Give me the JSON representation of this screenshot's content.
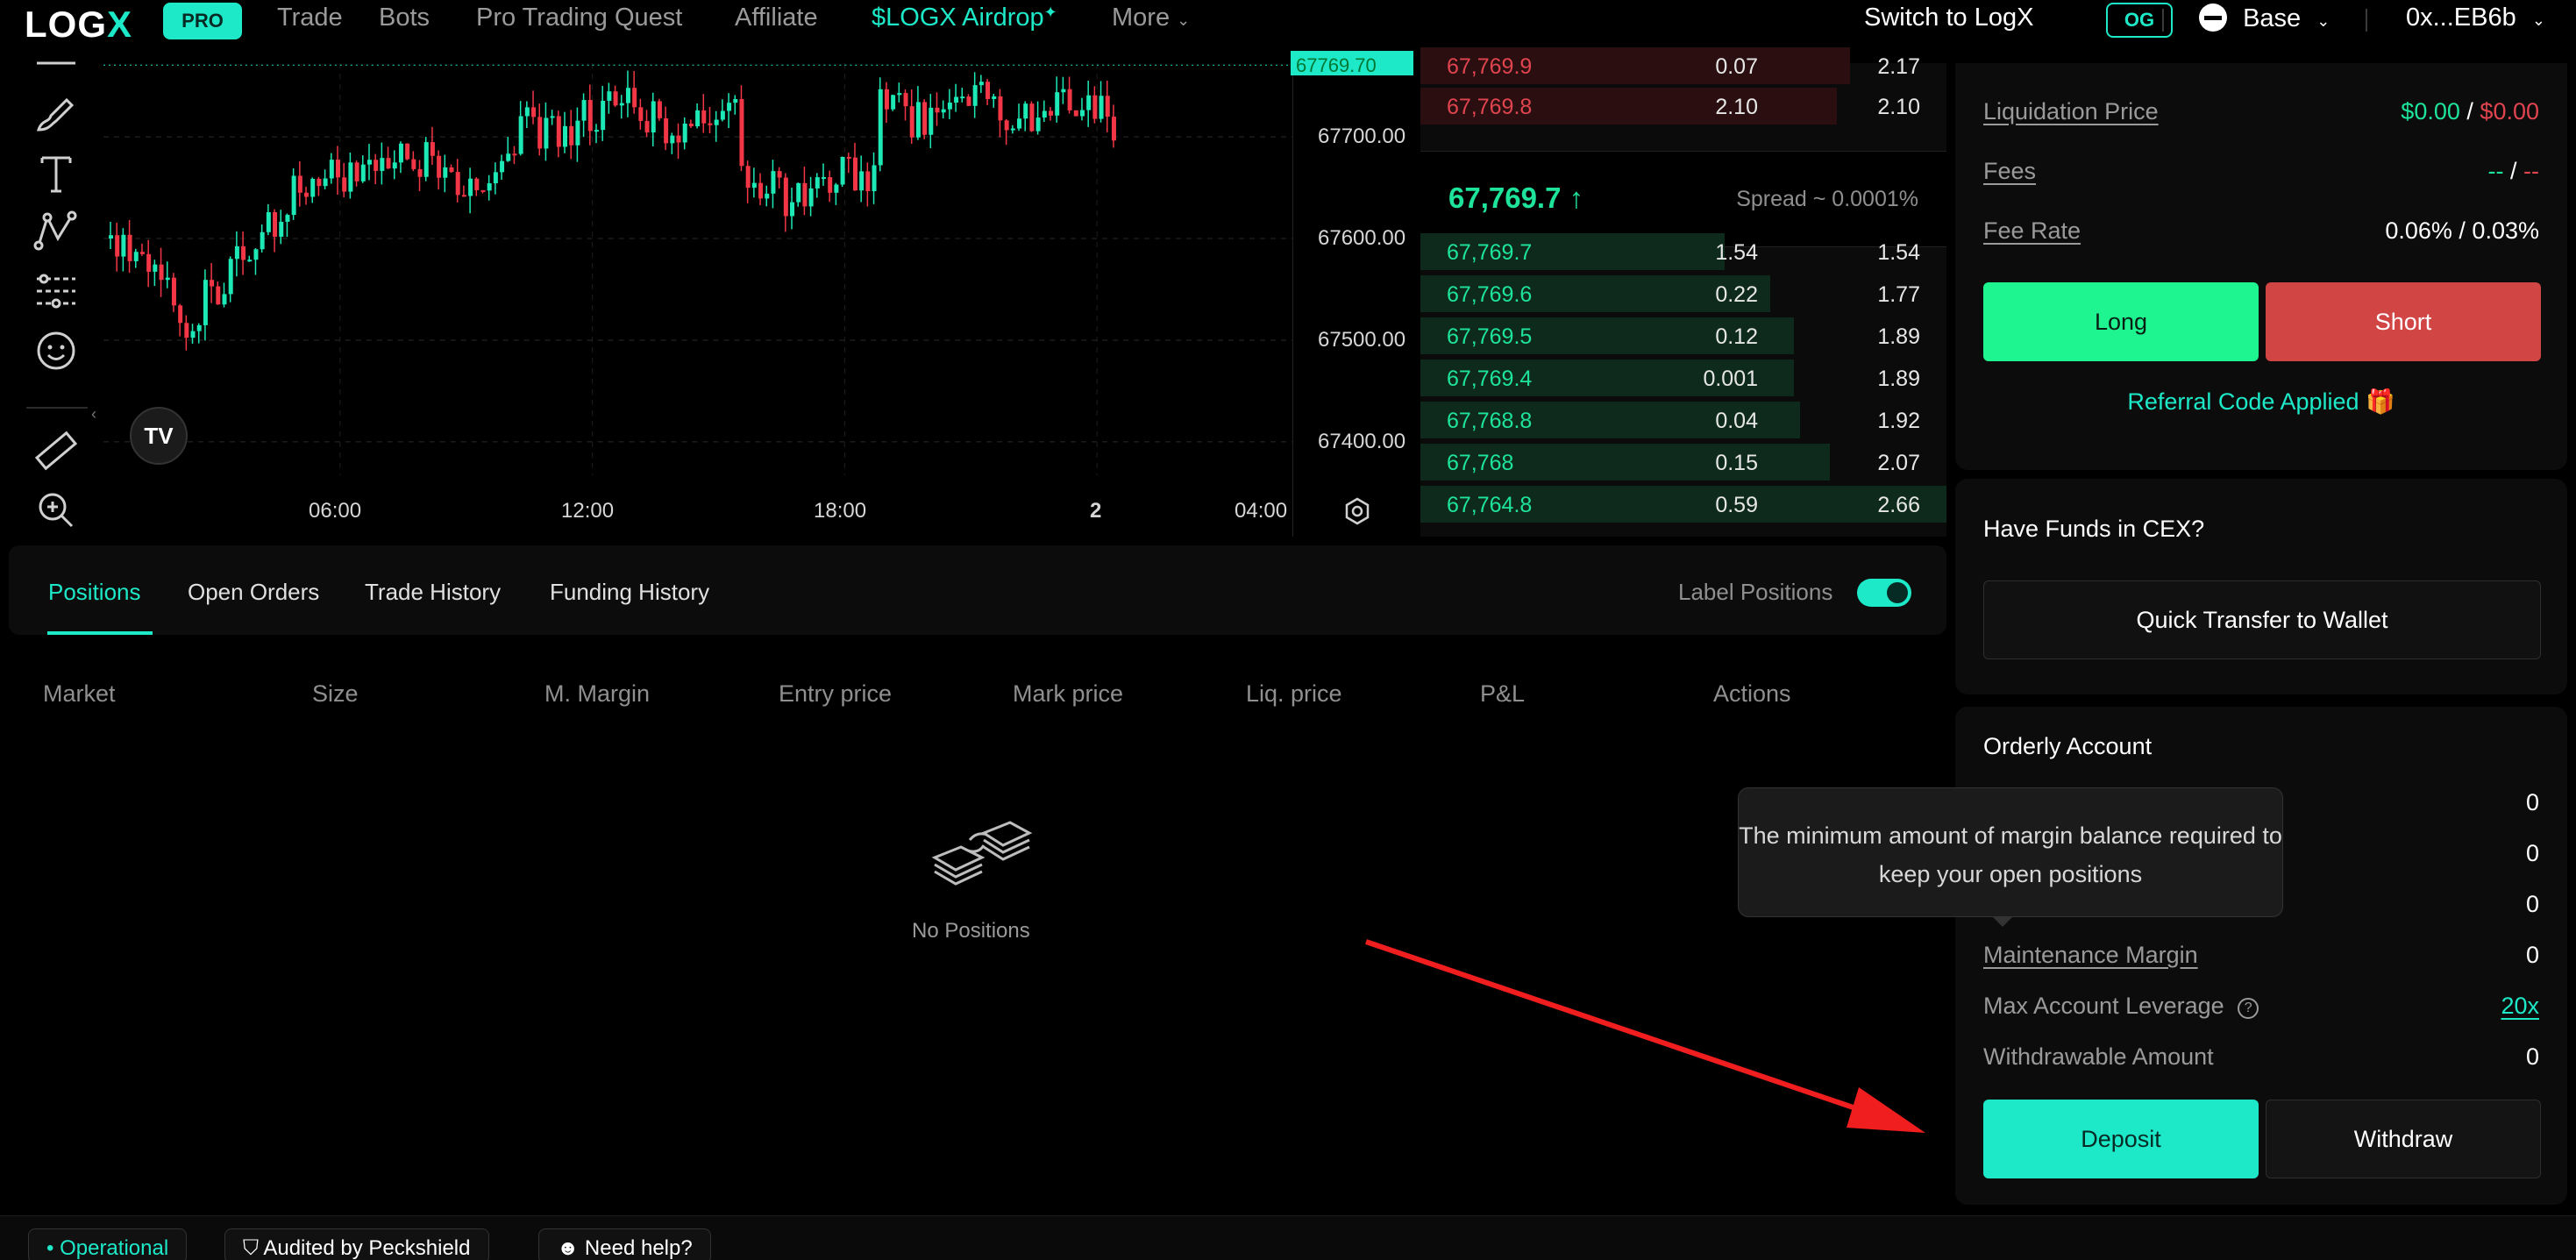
{
  "nav": {
    "logo": "LOGX",
    "pro_badge": "PRO",
    "items": [
      "Trade",
      "Bots",
      "Pro Trading Quest",
      "Affiliate",
      "$LOGX Airdrop",
      "More"
    ],
    "switch_label": "Switch to LogX",
    "og_badge": "OG",
    "network": "Base",
    "wallet": "0x...EB6b"
  },
  "chart": {
    "price_axis": [
      "67700.00",
      "67600.00",
      "67500.00",
      "67400.00"
    ],
    "time_axis": [
      "06:00",
      "12:00",
      "18:00",
      "2",
      "04:00"
    ],
    "current_tag": "67769.70",
    "tv_logo": "TV"
  },
  "orderbook": {
    "asks": [
      {
        "price": "67,769.9",
        "size": "0.07",
        "total": "2.17"
      },
      {
        "price": "67,769.8",
        "size": "2.10",
        "total": "2.10"
      }
    ],
    "last_price": "67,769.7 ↑",
    "spread": "Spread ~ 0.0001%",
    "bids": [
      {
        "price": "67,769.7",
        "size": "1.54",
        "total": "1.54"
      },
      {
        "price": "67,769.6",
        "size": "0.22",
        "total": "1.77"
      },
      {
        "price": "67,769.5",
        "size": "0.12",
        "total": "1.89"
      },
      {
        "price": "67,769.4",
        "size": "0.001",
        "total": "1.89"
      },
      {
        "price": "67,768.8",
        "size": "0.04",
        "total": "1.92"
      },
      {
        "price": "67,768",
        "size": "0.15",
        "total": "2.07"
      },
      {
        "price": "67,764.8",
        "size": "0.59",
        "total": "2.66"
      }
    ]
  },
  "positions": {
    "tabs": [
      "Positions",
      "Open Orders",
      "Trade History",
      "Funding History"
    ],
    "toggle_label": "Label Positions",
    "columns": [
      "Market",
      "Size",
      "M. Margin",
      "Entry price",
      "Mark price",
      "Liq. price",
      "P&L",
      "Actions"
    ],
    "empty_text": "No Positions"
  },
  "trade_panel": {
    "liquidation_label": "Liquidation Price",
    "liquidation_long": "$0.00",
    "liquidation_sep": "/",
    "liquidation_short": "$0.00",
    "fees_label": "Fees",
    "fees_long": "--",
    "fees_sep": "/",
    "fees_short": "--",
    "fee_rate_label": "Fee Rate",
    "fee_rate_value": "0.06% / 0.03%",
    "long_button": "Long",
    "short_button": "Short",
    "referral": "Referral Code Applied 🎁"
  },
  "cex_panel": {
    "title": "Have Funds in CEX?",
    "transfer_button": "Quick Transfer to Wallet"
  },
  "account": {
    "title": "Orderly Account",
    "hidden_values": [
      "0",
      "0",
      "0"
    ],
    "maintenance_label": "Maintenance Margin",
    "maintenance_value": "0",
    "leverage_label": "Max Account Leverage",
    "leverage_value": "20x",
    "withdrawable_label": "Withdrawable Amount",
    "withdrawable_value": "0",
    "deposit_button": "Deposit",
    "withdraw_button": "Withdraw",
    "tooltip": "The minimum amount of margin balance required to keep your open positions"
  },
  "footer": {
    "status": "Operational",
    "audit": "Audited by Peckshield",
    "help": "Need help?"
  },
  "colors": {
    "accent": "#1de9c8",
    "bid_green": "#1ee39a",
    "ask_red": "#e0454f",
    "short_red": "#d14545",
    "arrow_red": "#f01e1e"
  }
}
